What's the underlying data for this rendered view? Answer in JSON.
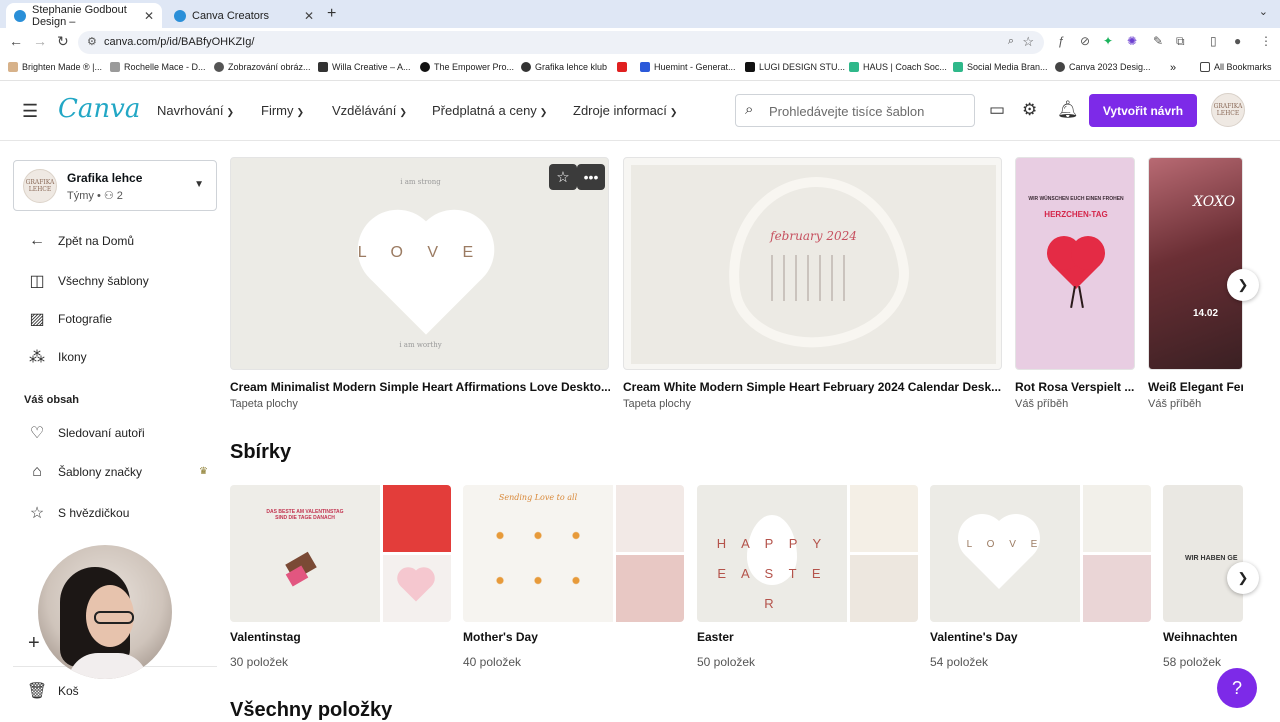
{
  "browser": {
    "tabs": [
      {
        "title": "Stephanie Godbout Design –",
        "active": true
      },
      {
        "title": "Canva Creators",
        "active": false
      }
    ],
    "url": "canva.com/p/id/BABfyOHKZIg/",
    "bookmarks": [
      "Brighten Made ® |...",
      "Rochelle Mace - D...",
      "Zobrazování obráz...",
      "Willa Creative – A...",
      "The Empower Pro...",
      "Grafika lehce klub",
      "",
      "Huemint - Generat...",
      "LUGI DESIGN STU...",
      "HAUS | Coach Soc...",
      "Social Media Bran...",
      "Canva 2023 Desig..."
    ],
    "all_bookmarks": "All Bookmarks"
  },
  "header": {
    "logo": "Canva",
    "nav": [
      "Navrhování",
      "Firmy",
      "Vzdělávání",
      "Předplatná a ceny",
      "Zdroje informací"
    ],
    "search_placeholder": "Prohledávejte tisíce šablon",
    "create_button": "Vytvořit návrh",
    "avatar_text": "GRAFIKA LEHCE"
  },
  "sidebar": {
    "team_name": "Grafika lehce",
    "team_meta": "Týmy • ",
    "team_count": "2",
    "team_avatar_text": "GRAFIKA LEHCE",
    "items": [
      {
        "label": "Zpět na Domů",
        "icon": "arrow-left-icon"
      },
      {
        "label": "Všechny šablony",
        "icon": "template-icon"
      },
      {
        "label": "Fotografie",
        "icon": "image-icon"
      },
      {
        "label": "Ikony",
        "icon": "shapes-icon"
      }
    ],
    "section_label": "Váš obsah",
    "content_items": [
      {
        "label": "Sledovaní autoři",
        "icon": "heart-icon"
      },
      {
        "label": "Šablony značky",
        "icon": "brand-icon"
      },
      {
        "label": "S hvězdičkou",
        "icon": "star-icon"
      }
    ],
    "trash_label": "Koš"
  },
  "templates": [
    {
      "title": "Cream Minimalist Modern Simple Heart Affirmations Love Deskto...",
      "type": "Tapeta plochy",
      "top_text": "i am strong",
      "word": "L O V E",
      "bottom_text": "i am worthy"
    },
    {
      "title": "Cream White Modern Simple Heart February 2024 Calendar Desk...",
      "type": "Tapeta plochy",
      "month": "february 2024"
    },
    {
      "title": "Rot Rosa Verspielt ...",
      "type": "Váš příběh",
      "text1": "WIR WÜNSCHEN EUCH EINEN FROHEN",
      "text2": "HERZCHEN-TAG"
    },
    {
      "title": "Weiß Elegant Fen",
      "type": "Váš příběh",
      "text1": "XOXO",
      "text2": "14.02"
    }
  ],
  "collections_heading": "Sbírky",
  "collections": [
    {
      "title": "Valentinstag",
      "count": "30 položek",
      "text": "DAS BESTE AM VALENTINSTAG SIND DIE TAGE DANACH"
    },
    {
      "title": "Mother's Day",
      "count": "40 položek",
      "text": "Sending Love to all"
    },
    {
      "title": "Easter",
      "count": "50 položek",
      "text": "H A P P Y   E A S T E R"
    },
    {
      "title": "Valentine's Day",
      "count": "54 položek",
      "text": "L O V E"
    },
    {
      "title": "Weihnachten",
      "count": "58 položek",
      "text": "WIR HABEN GE"
    }
  ],
  "all_items_heading": "Všechny položky",
  "help_label": "?"
}
